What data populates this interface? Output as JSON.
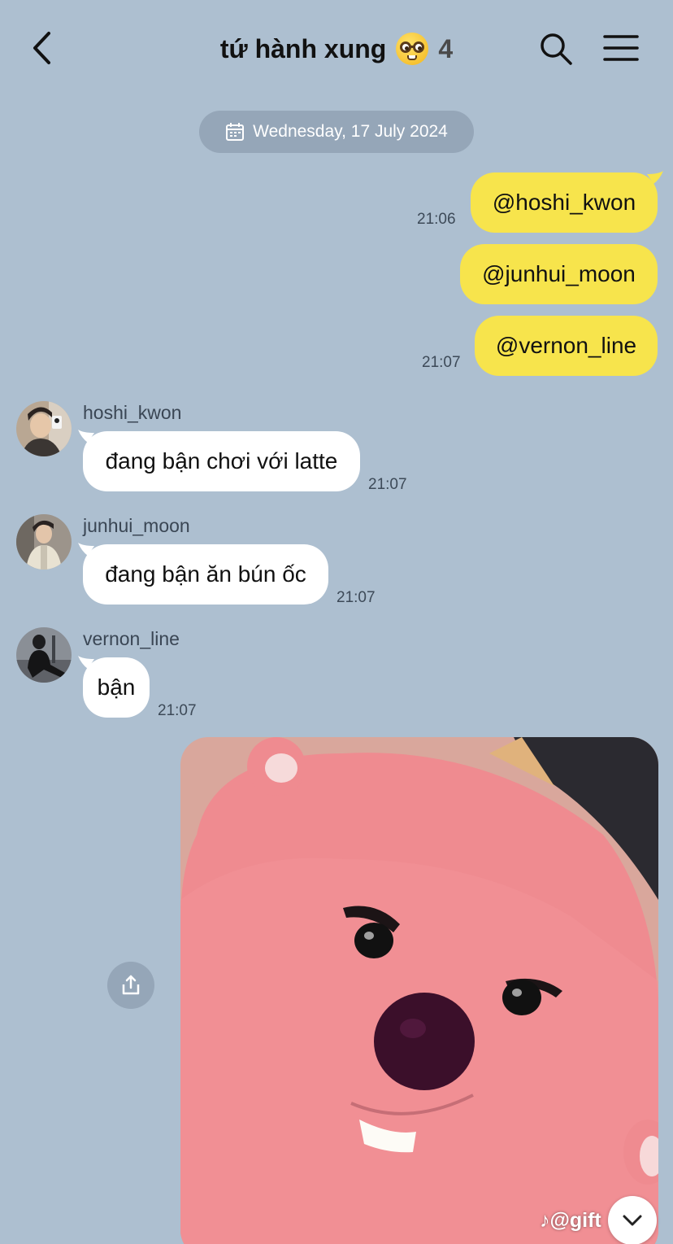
{
  "header": {
    "title": "tứ hành xung",
    "title_emoji": "nerd-face-emoji",
    "member_count": "4"
  },
  "date_separator": {
    "icon": "calendar-icon",
    "label": "Wednesday, 17 July 2024"
  },
  "messages": [
    {
      "from": "me",
      "text": "@hoshi_kwon",
      "time": "21:06"
    },
    {
      "from": "me",
      "text": "@junhui_moon",
      "time": ""
    },
    {
      "from": "me",
      "text": "@vernon_line",
      "time": "21:07"
    },
    {
      "from": "hoshi_kwon",
      "sender": "hoshi_kwon",
      "text": "đang bận chơi với latte",
      "time": "21:07"
    },
    {
      "from": "junhui_moon",
      "sender": "junhui_moon",
      "text": "đang bận ăn bún ốc",
      "time": "21:07"
    },
    {
      "from": "vernon_line",
      "sender": "vernon_line",
      "text": "bận",
      "time": "21:07"
    },
    {
      "from": "me",
      "type": "image",
      "image_desc": "pink beaver character",
      "watermark": "@gift"
    }
  ],
  "icons": {
    "back": "chevron-left-icon",
    "search": "search-icon",
    "menu": "menu-icon",
    "share": "share-icon",
    "scroll_down": "chevron-down-icon"
  },
  "colors": {
    "background": "#adbfd0",
    "my_bubble": "#f7e44c",
    "other_bubble": "#ffffff",
    "date_pill": "#95a6b8"
  }
}
